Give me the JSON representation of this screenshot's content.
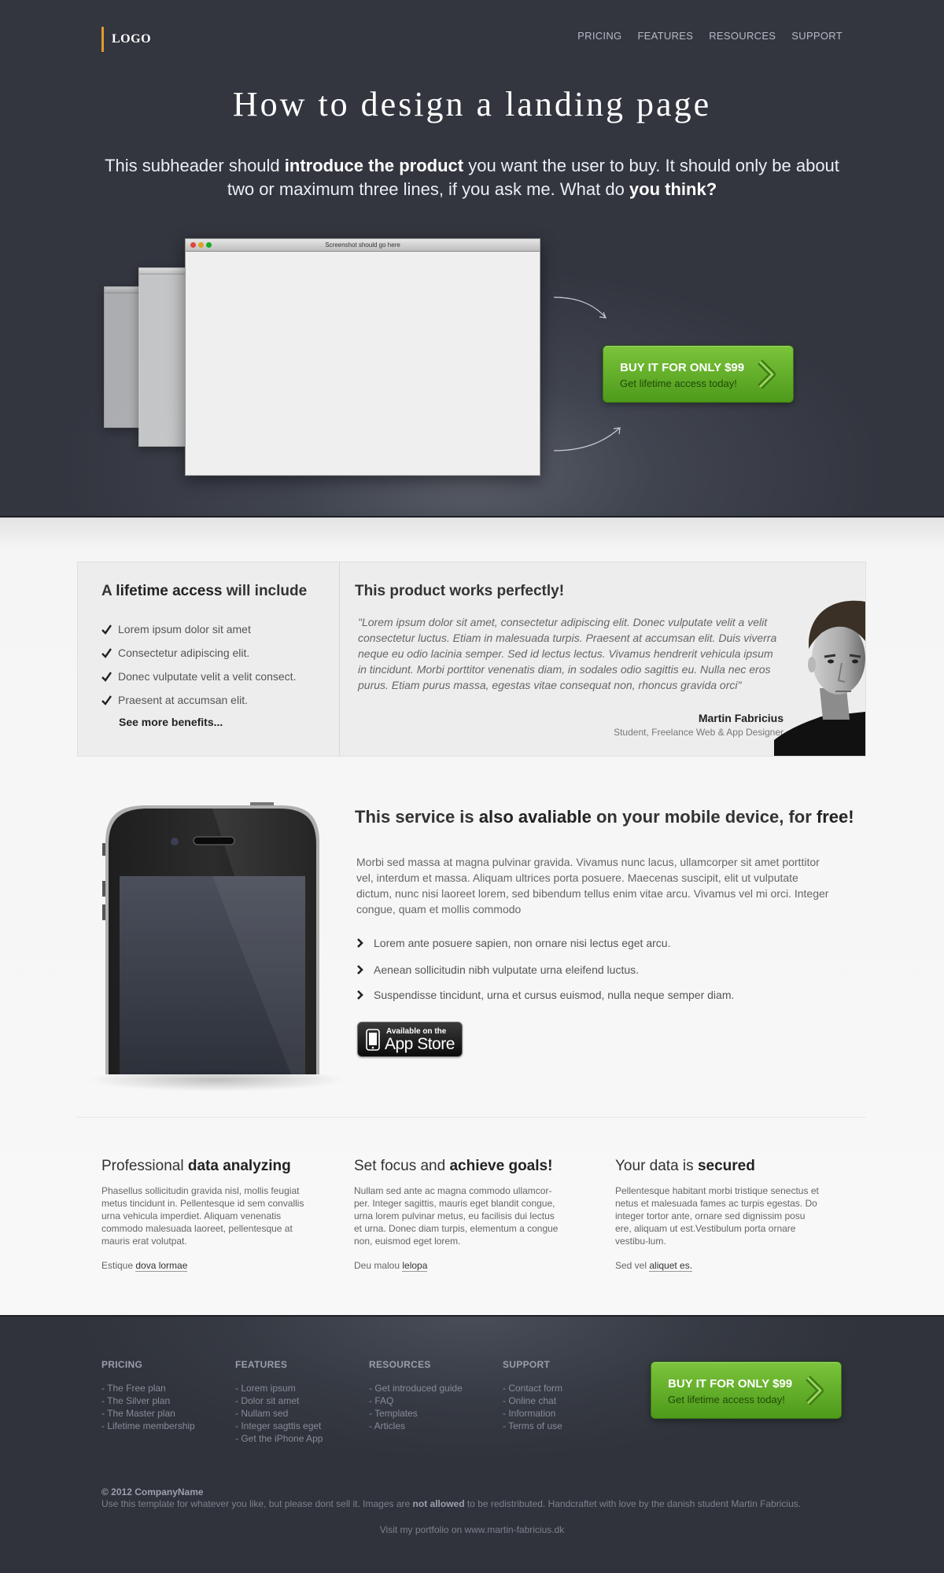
{
  "header": {
    "logo": "LOGO",
    "nav": [
      "PRICING",
      "FEATURES",
      "RESOURCES",
      "SUPPORT"
    ]
  },
  "hero": {
    "title": "How to design a landing page",
    "subtitle_parts": [
      "This subheader should ",
      "introduce the product",
      " you want the user to buy. It should only be about two or maximum three lines, if you ask me. What do ",
      "you think?"
    ],
    "screenshot_label": "Screenshot should go here",
    "cta": {
      "line1": "BUY IT FOR ONLY $99",
      "line2": "Get lifetime access today!"
    }
  },
  "lifetime": {
    "title_parts": [
      "A ",
      "lifetime access",
      " will include"
    ],
    "benefits": [
      "Lorem ipsum dolor sit amet",
      "Consectetur adipiscing elit.",
      "Donec vulputate velit a velit consect.",
      "Praesent at accumsan elit."
    ],
    "more": "See more benefits..."
  },
  "testimonial": {
    "title_parts": [
      "This product works ",
      "perfectly!"
    ],
    "quote": "\"Lorem ipsum dolor sit amet, consectetur adipiscing elit. Donec vulputate velit a velit consectetur luctus. Etiam in malesuada turpis. Praesent at accumsan elit. Duis viverra neque eu odio lacinia semper. Sed id lectus lectus. Vivamus hendrerit vehicula ipsum in tincidunt. Morbi porttitor venenatis diam, in sodales odio sagittis eu. Nulla nec eros purus. Etiam purus massa, egestas vitae consequat non, rhoncus gravida orci\"",
    "name": "Martin Fabricius",
    "role": "Student, Freelance Web & App Designer"
  },
  "mobile": {
    "title_parts": [
      "This service is ",
      "also avaliable",
      " on your mobile device, for ",
      "free!"
    ],
    "body": "Morbi sed massa at magna pulvinar gravida. Vivamus nunc lacus, ullamcorper sit amet porttitor vel, interdum et massa. Aliquam ultrices porta posuere. Maecenas suscipit, elit ut vulputate dictum, nunc nisi laoreet lorem, sed bibendum tellus enim vitae arcu. Vivamus vel mi orci. Integer congue, quam et mollis commodo",
    "items": [
      "Lorem ante posuere sapien, non ornare nisi lectus eget arcu.",
      "Aenean sollicitudin nibh vulputate urna eleifend luctus.",
      "Suspendisse tincidunt, urna et cursus euismod, nulla neque semper diam."
    ],
    "appstore": {
      "small": "Available on the",
      "big": "App Store"
    }
  },
  "features": [
    {
      "title_parts": [
        "Professional ",
        "data analyzing"
      ],
      "body": "Phasellus sollicitudin gravida nisl, mollis feugiat metus tincidunt in. Pellentesque id sem convallis urna vehicula imperdiet. Aliquam venenatis commodo malesuada laoreet, pellentesque at mauris erat volutpat.",
      "link_prefix": "Estique ",
      "link": "dova lormae"
    },
    {
      "title_parts": [
        "Set focus and ",
        "achieve goals!"
      ],
      "body": "Nullam sed ante ac magna commodo ullamcor-per. Integer sagittis, mauris eget blandit congue, urna lorem pulvinar metus, eu facilisis dui lectus et urna. Donec diam turpis, elementum a congue non, euismod eget lorem.",
      "link_prefix": "Deu malou ",
      "link": "lelopa"
    },
    {
      "title_parts": [
        "Your data is ",
        "secured"
      ],
      "body": "Pellentesque habitant morbi tristique senectus et netus et malesuada fames ac turpis egestas. Do integer tortor ante, ornare sed dignissim posu ere, aliquam ut est.Vestibulum porta ornare vestibu-lum.",
      "link_prefix": "Sed vel ",
      "link": "aliquet es."
    }
  ],
  "footer": {
    "columns": [
      {
        "title": "PRICING",
        "items": [
          "- The Free plan",
          "- The Silver plan",
          "- The Master plan",
          "- Lifetime membership"
        ]
      },
      {
        "title": "FEATURES",
        "items": [
          "- Lorem ipsum",
          "- Dolor sit amet",
          "- Nullam sed",
          "- Integer sagttis eget",
          "- Get the iPhone App"
        ]
      },
      {
        "title": "RESOURCES",
        "items": [
          "- Get introduced guide",
          "- FAQ",
          "- Templates",
          "- Articles"
        ]
      },
      {
        "title": "SUPPORT",
        "items": [
          "- Contact form",
          "- Online chat",
          "- Information",
          "- Terms of use"
        ]
      }
    ],
    "cta": {
      "line1": "BUY IT FOR ONLY $99",
      "line2": "Get lifetime access today!"
    },
    "copyright": "© 2012 CompanyName",
    "license_parts": [
      "Use this template for whatever you like, but please dont sell it. Images are ",
      "not allowed",
      " to be redistributed. Handcraftet with love by the danish student Martin Fabricius."
    ],
    "portfolio": "Visit my portfolio on www.martin-fabricius.dk"
  },
  "colors": {
    "accent_green": "#5fae25",
    "hero_bg": "#3a3e48",
    "logo_bar": "#e39a2e"
  }
}
